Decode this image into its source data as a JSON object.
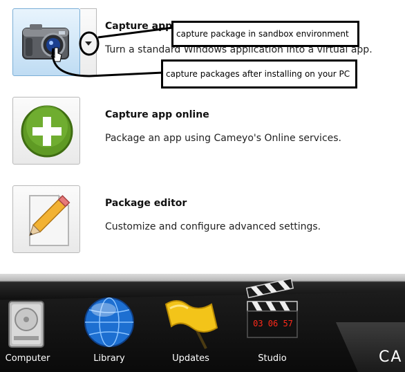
{
  "options": [
    {
      "title": "Capture app locally",
      "description": "Turn a standard Windows application into a virtual app.",
      "icon": "camera-icon"
    },
    {
      "title": "Capture app online",
      "description": "Package an app using Cameyo's Online services.",
      "icon": "plus-circle-icon"
    },
    {
      "title": "Package editor",
      "description": "Customize and configure advanced settings.",
      "icon": "pencil-document-icon"
    }
  ],
  "callouts": {
    "sandbox": "capture package in sandbox environment",
    "installed": "capture packages after installing on your PC"
  },
  "dock": [
    {
      "label": "Computer",
      "icon": "hard-drive-icon"
    },
    {
      "label": "Library",
      "icon": "globe-icon"
    },
    {
      "label": "Updates",
      "icon": "flag-icon"
    },
    {
      "label": "Studio",
      "icon": "clapperboard-icon"
    }
  ],
  "studio_display": "03 06 57",
  "brand": "CA",
  "colors": {
    "accent_green": "#6aa22b",
    "tile_active": "#bfdcf3",
    "taskbar": "#0d0d0d"
  }
}
